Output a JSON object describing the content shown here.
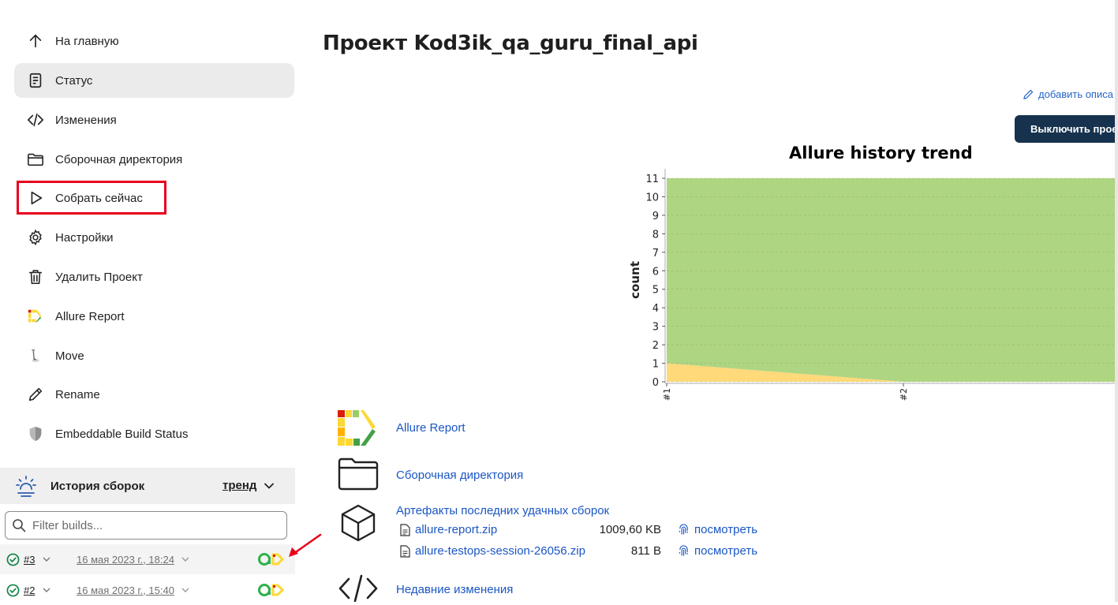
{
  "sidebar": {
    "items": [
      {
        "label": "На главную",
        "icon": "arrow-up-icon"
      },
      {
        "label": "Статус",
        "icon": "document-icon"
      },
      {
        "label": "Изменения",
        "icon": "code-icon"
      },
      {
        "label": "Сборочная директория",
        "icon": "folder-icon"
      },
      {
        "label": "Собрать сейчас",
        "icon": "play-icon"
      },
      {
        "label": "Настройки",
        "icon": "gear-icon"
      },
      {
        "label": "Удалить Проект",
        "icon": "trash-icon"
      },
      {
        "label": "Allure Report",
        "icon": "allure-logo-icon"
      },
      {
        "label": "Move",
        "icon": "move-icon"
      },
      {
        "label": "Rename",
        "icon": "pencil-icon"
      },
      {
        "label": "Embeddable Build Status",
        "icon": "shield-icon"
      }
    ],
    "active_item": "Статус",
    "highlighted_item": "Собрать сейчас"
  },
  "history": {
    "title": "История сборок",
    "trend_label": "тренд",
    "filter_placeholder": "Filter builds...",
    "builds": [
      {
        "number": "#3",
        "date": "16 мая 2023 г., 18:24",
        "status": "success"
      },
      {
        "number": "#2",
        "date": "16 мая 2023 г., 15:40",
        "status": "success"
      }
    ]
  },
  "main": {
    "title": "Проект Kod3ik_qa_guru_final_api",
    "add_description_label": "добавить описа",
    "disable_button_label": "Выключить прое",
    "sections": {
      "allure_report": "Allure Report",
      "workspace": "Сборочная директория",
      "artifacts_title": "Артефакты последних удачных сборок",
      "recent_changes": "Недавние изменения"
    },
    "artifacts": [
      {
        "name": "allure-report.zip",
        "size": "1009,60 KB",
        "view": "посмотреть"
      },
      {
        "name": "allure-testops-session-26056.zip",
        "size": "811 B",
        "view": "посмотреть"
      }
    ]
  },
  "colors": {
    "link": "#1a56c4",
    "button_bg": "#16324e",
    "highlight_red": "#e8001c",
    "passed_green": "#aed581",
    "broken_yellow": "#ffd97a"
  },
  "chart_data": {
    "type": "area",
    "title": "Allure history trend",
    "ylabel": "count",
    "xlabel": "",
    "x": [
      "#1",
      "#2"
    ],
    "ylim": [
      0,
      11
    ],
    "yticks": [
      "0",
      "1",
      "2",
      "3",
      "4",
      "5",
      "6",
      "7",
      "8",
      "9",
      "10",
      "11"
    ],
    "series": [
      {
        "values": [
          1,
          0
        ],
        "color": "#ffd97a"
      },
      {
        "values": [
          10,
          11
        ],
        "color": "#aed581"
      }
    ],
    "grid": true
  }
}
